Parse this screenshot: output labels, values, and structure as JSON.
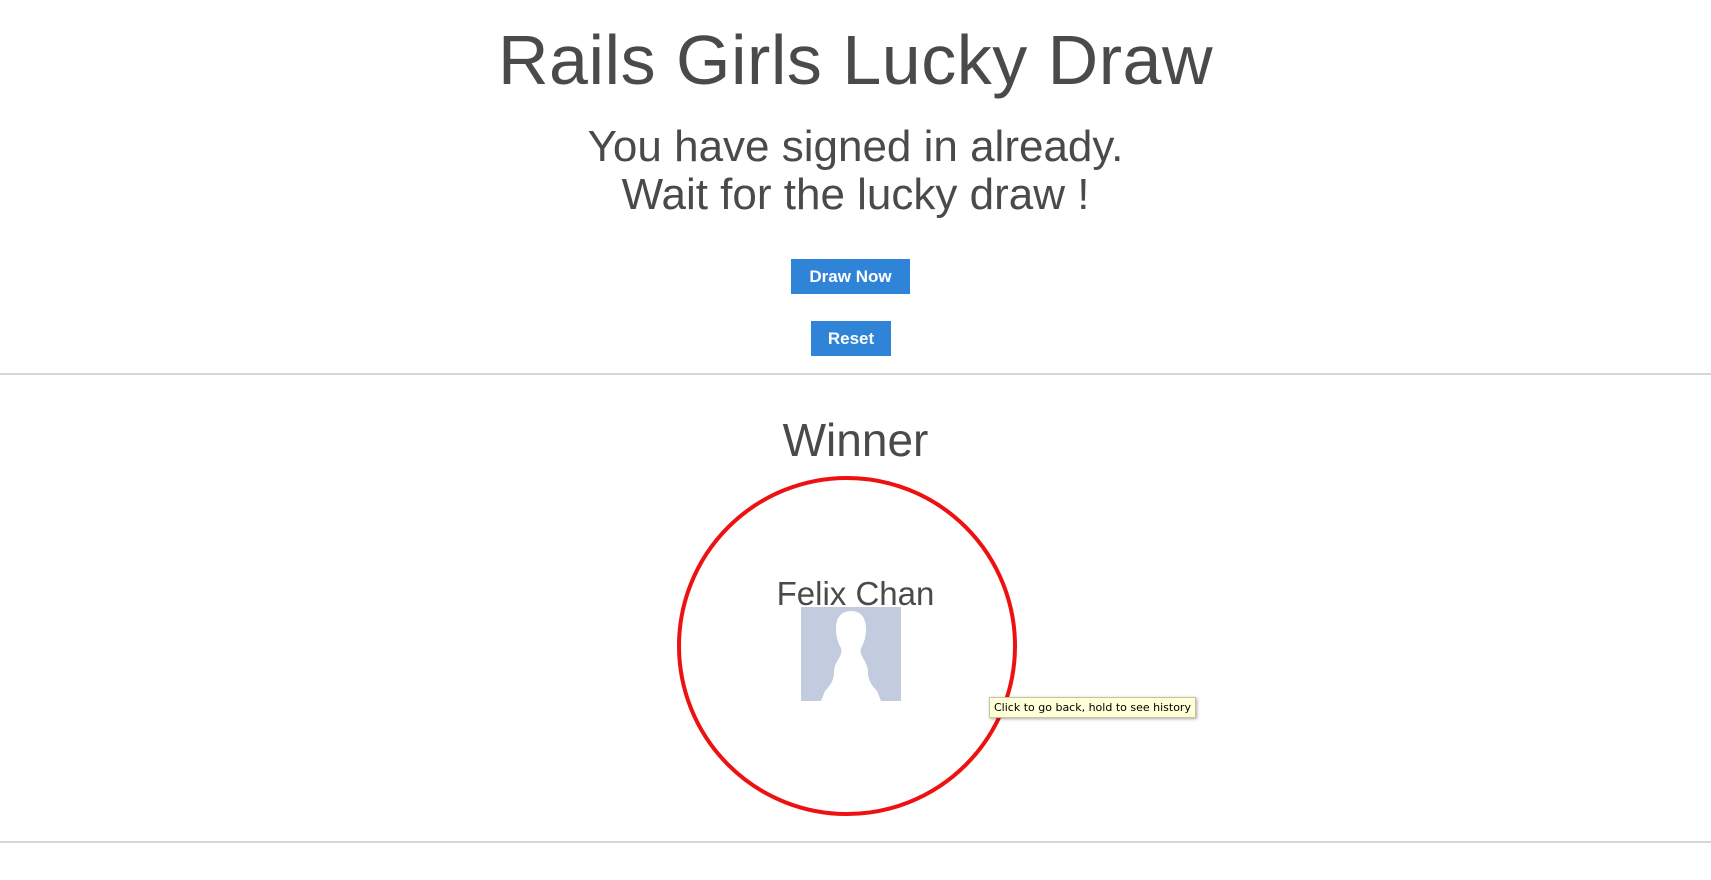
{
  "header": {
    "title": "Rails Girls Lucky Draw",
    "message_line1": "You have signed in already.",
    "message_line2": "Wait for the lucky draw !"
  },
  "actions": {
    "draw_label": "Draw Now",
    "reset_label": "Reset"
  },
  "winner": {
    "heading": "Winner",
    "name": "Felix Chan",
    "avatar_icon": "default-profile-silhouette-icon"
  },
  "tooltip": {
    "text": "Click to go back, hold to see history"
  },
  "colors": {
    "button": "#2f84d8",
    "circle": "#ee1111",
    "avatar_bg": "#c3ccdf",
    "text": "#4a4a4a"
  }
}
